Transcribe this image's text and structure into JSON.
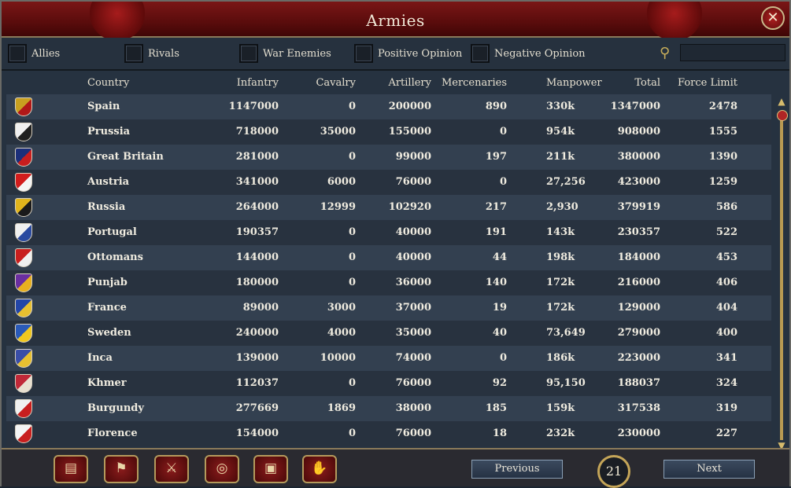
{
  "window": {
    "title": "Armies",
    "close_label": "✕"
  },
  "filters": [
    {
      "label": "Allies"
    },
    {
      "label": "Rivals"
    },
    {
      "label": "War Enemies"
    },
    {
      "label": "Positive Opinion"
    },
    {
      "label": "Negative Opinion"
    }
  ],
  "search": {
    "value": "",
    "icon": "magnifier-icon"
  },
  "columns": {
    "country": "Country",
    "infantry": "Infantry",
    "cavalry": "Cavalry",
    "artillery": "Artillery",
    "mercenaries": "Mercenaries",
    "manpower": "Manpower",
    "total": "Total",
    "force_limit": "Force Limit"
  },
  "rows": [
    {
      "country": "Spain",
      "infantry": "1147000",
      "cavalry": "0",
      "artillery": "200000",
      "mercenaries": "890",
      "manpower": "330k",
      "total": "1347000",
      "force_limit": "2478",
      "flag": [
        "#c8a020",
        "#b01818"
      ]
    },
    {
      "country": "Prussia",
      "infantry": "718000",
      "cavalry": "35000",
      "artillery": "155000",
      "mercenaries": "0",
      "manpower": "954k",
      "total": "908000",
      "force_limit": "1555",
      "flag": [
        "#f0f0f0",
        "#202020"
      ]
    },
    {
      "country": "Great Britain",
      "infantry": "281000",
      "cavalry": "0",
      "artillery": "99000",
      "mercenaries": "197",
      "manpower": "211k",
      "total": "380000",
      "force_limit": "1390",
      "flag": [
        "#1c2f7a",
        "#c81e1e"
      ]
    },
    {
      "country": "Austria",
      "infantry": "341000",
      "cavalry": "6000",
      "artillery": "76000",
      "mercenaries": "0",
      "manpower": "27,256",
      "total": "423000",
      "force_limit": "1259",
      "flag": [
        "#d21c1c",
        "#f4f4f4"
      ]
    },
    {
      "country": "Russia",
      "infantry": "264000",
      "cavalry": "12999",
      "artillery": "102920",
      "mercenaries": "217",
      "manpower": "2,930",
      "total": "379919",
      "force_limit": "586",
      "flag": [
        "#e0b41c",
        "#1a1a1a"
      ]
    },
    {
      "country": "Portugal",
      "infantry": "190357",
      "cavalry": "0",
      "artillery": "40000",
      "mercenaries": "191",
      "manpower": "143k",
      "total": "230357",
      "force_limit": "522",
      "flag": [
        "#f0f0f0",
        "#2a4aa0"
      ]
    },
    {
      "country": "Ottomans",
      "infantry": "144000",
      "cavalry": "0",
      "artillery": "40000",
      "mercenaries": "44",
      "manpower": "198k",
      "total": "184000",
      "force_limit": "453",
      "flag": [
        "#c81e1e",
        "#f0f0f0"
      ]
    },
    {
      "country": "Punjab",
      "infantry": "180000",
      "cavalry": "0",
      "artillery": "36000",
      "mercenaries": "140",
      "manpower": "172k",
      "total": "216000",
      "force_limit": "406",
      "flag": [
        "#6a2ea0",
        "#e8b020"
      ]
    },
    {
      "country": "France",
      "infantry": "89000",
      "cavalry": "3000",
      "artillery": "37000",
      "mercenaries": "19",
      "manpower": "172k",
      "total": "129000",
      "force_limit": "404",
      "flag": [
        "#2346a8",
        "#e8c030"
      ]
    },
    {
      "country": "Sweden",
      "infantry": "240000",
      "cavalry": "4000",
      "artillery": "35000",
      "mercenaries": "40",
      "manpower": "73,649",
      "total": "279000",
      "force_limit": "400",
      "flag": [
        "#2a5ab8",
        "#f0c820"
      ]
    },
    {
      "country": "Inca",
      "infantry": "139000",
      "cavalry": "10000",
      "artillery": "74000",
      "mercenaries": "0",
      "manpower": "186k",
      "total": "223000",
      "force_limit": "341",
      "flag": [
        "#3a4ea8",
        "#e8c030"
      ]
    },
    {
      "country": "Khmer",
      "infantry": "112037",
      "cavalry": "0",
      "artillery": "76000",
      "mercenaries": "92",
      "manpower": "95,150",
      "total": "188037",
      "force_limit": "324",
      "flag": [
        "#c02838",
        "#e8e0d0"
      ]
    },
    {
      "country": "Burgundy",
      "infantry": "277669",
      "cavalry": "1869",
      "artillery": "38000",
      "mercenaries": "185",
      "manpower": "159k",
      "total": "317538",
      "force_limit": "319",
      "flag": [
        "#f0f0f0",
        "#c81e1e"
      ]
    },
    {
      "country": "Florence",
      "infantry": "154000",
      "cavalry": "0",
      "artillery": "76000",
      "mercenaries": "18",
      "manpower": "232k",
      "total": "230000",
      "force_limit": "227",
      "flag": [
        "#f4f4f4",
        "#c81e1e"
      ]
    }
  ],
  "footer": {
    "buttons": [
      {
        "name": "ledger-icon",
        "glyph": "▤"
      },
      {
        "name": "flag-icon",
        "glyph": "⚑"
      },
      {
        "name": "crossed-swords-icon",
        "glyph": "⚔"
      },
      {
        "name": "coins-icon",
        "glyph": "◎"
      },
      {
        "name": "trade-crate-icon",
        "glyph": "▣"
      },
      {
        "name": "handshake-icon",
        "glyph": "✋"
      }
    ],
    "previous_label": "Previous",
    "next_label": "Next",
    "page_number": "21"
  },
  "colors": {
    "header_red": "#6a1010",
    "gold_trim": "#c4a558",
    "row_odd": "#334050",
    "row_even": "#28323f"
  }
}
